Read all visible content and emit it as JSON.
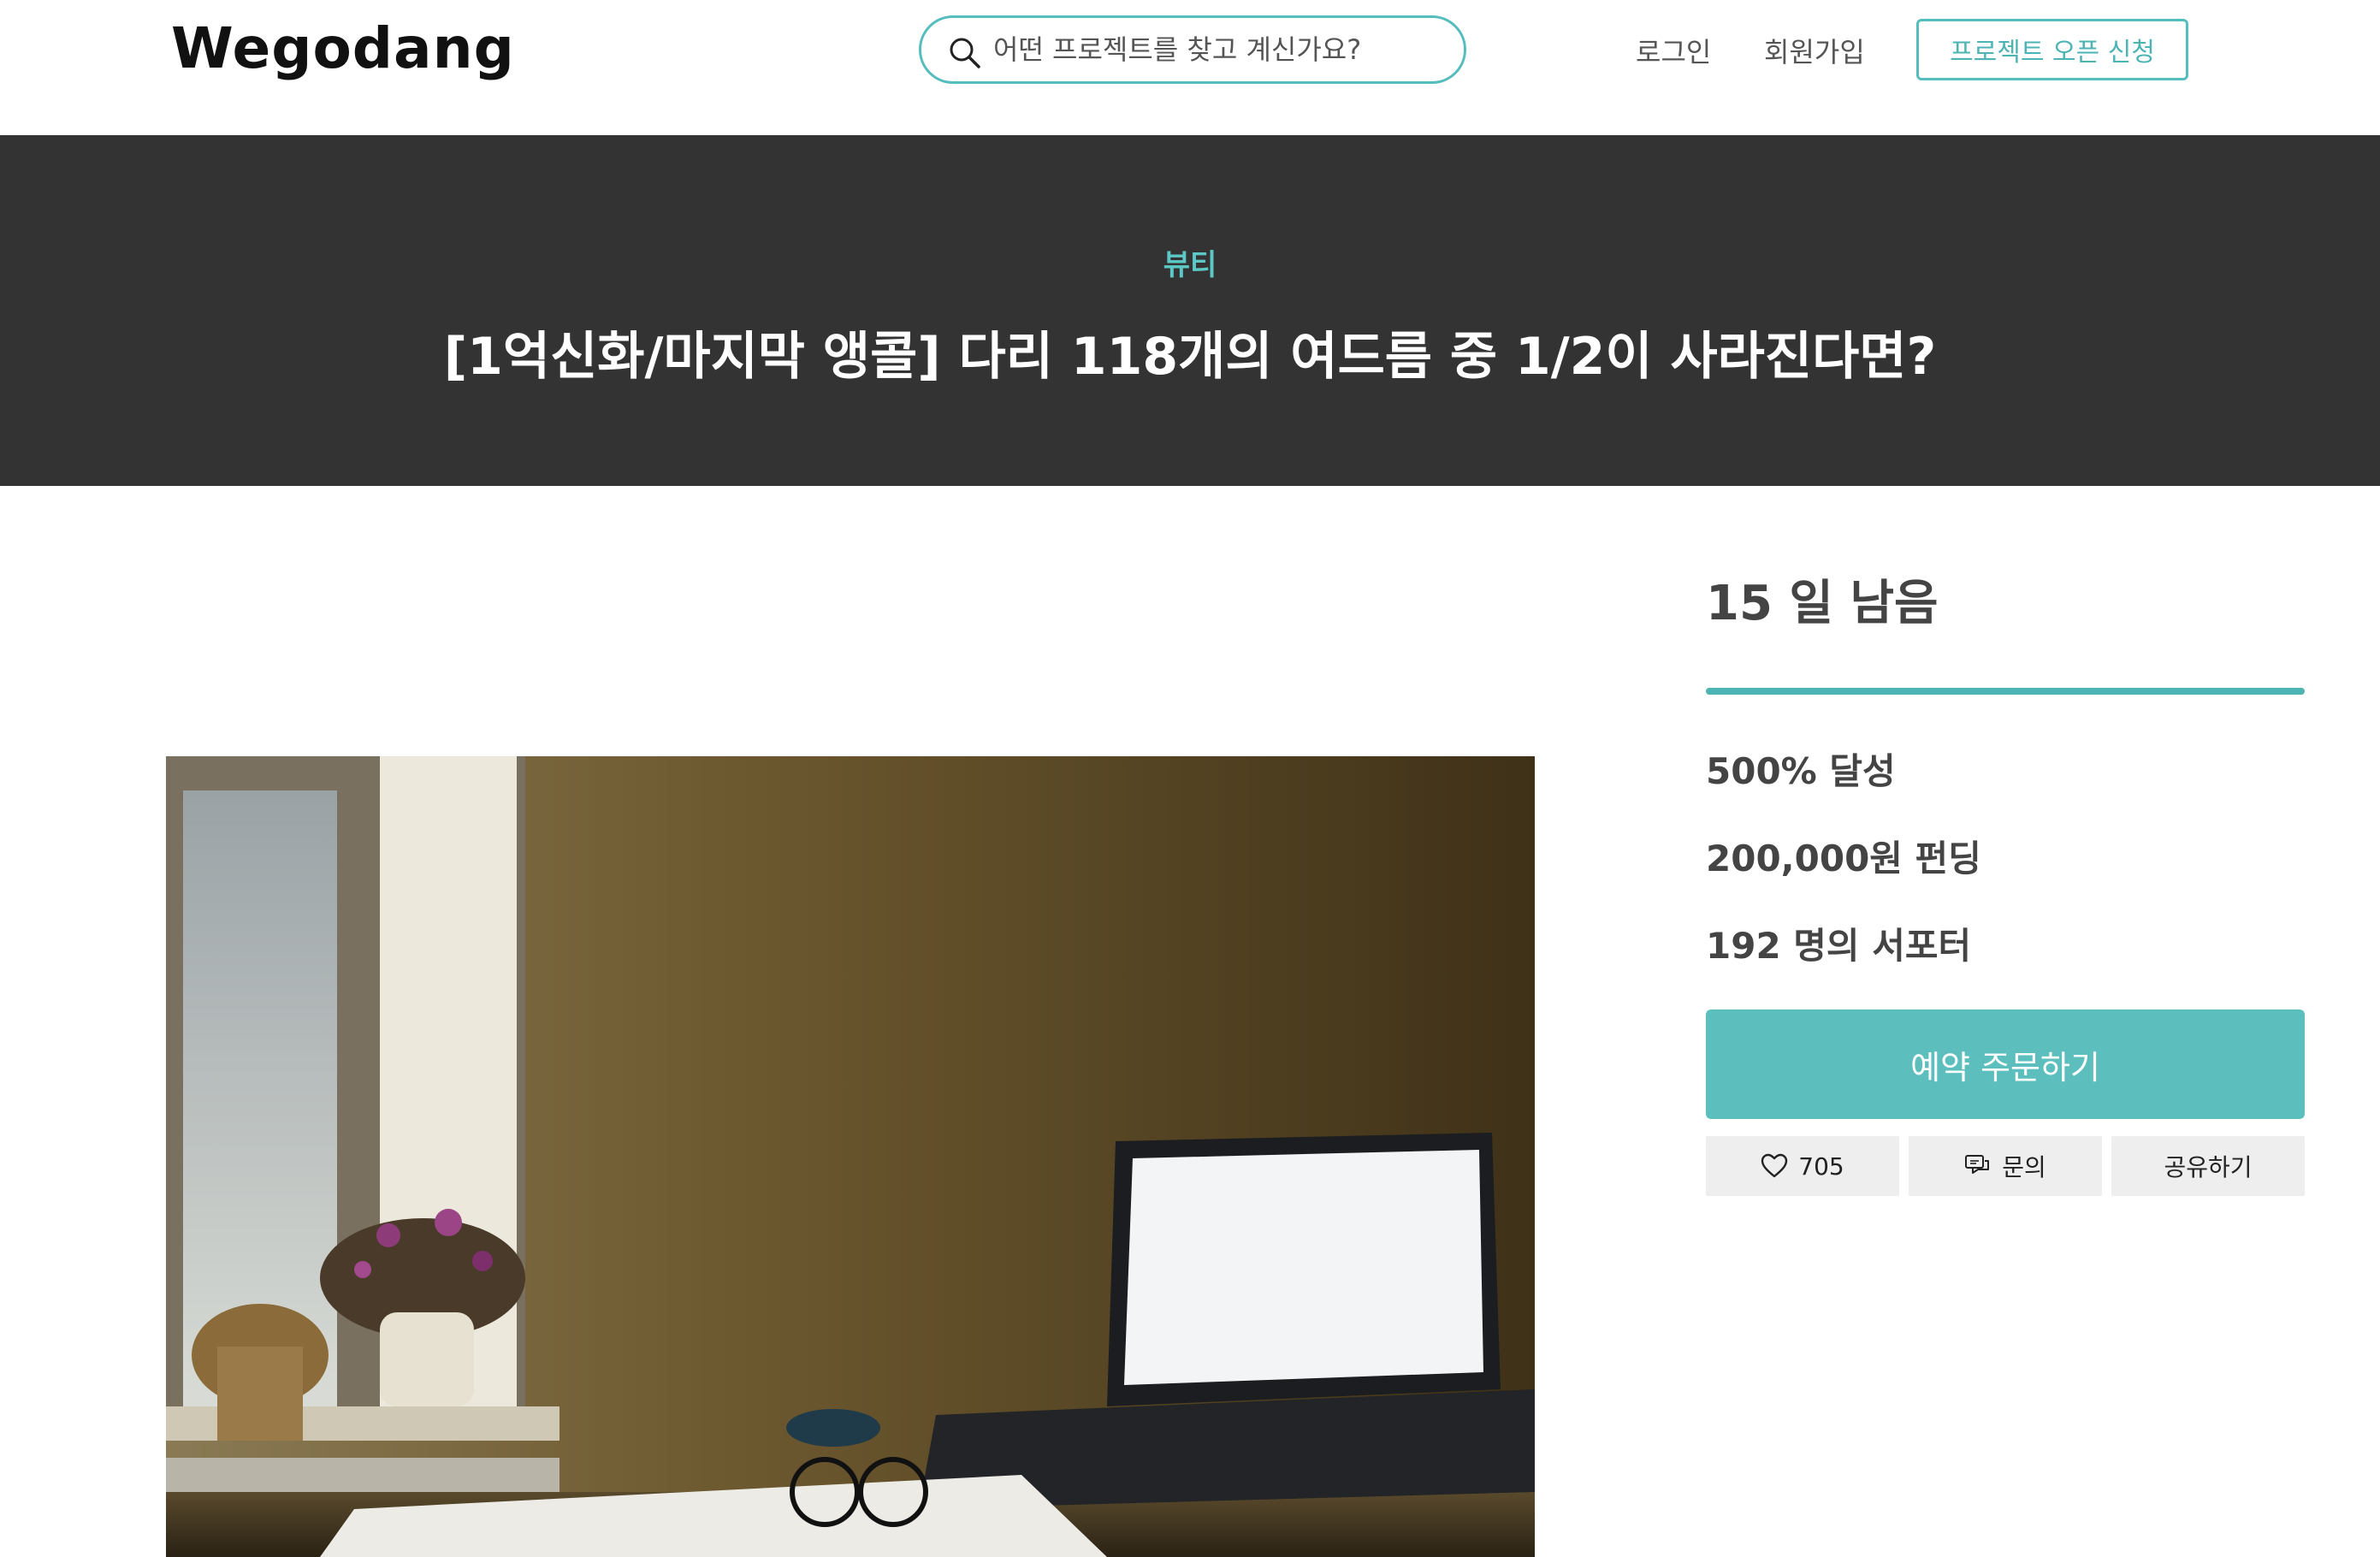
{
  "header": {
    "logo": "Wegodang",
    "search_placeholder": "어떤 프로젝트를 찾고 계신가요?",
    "login": "로그인",
    "signup": "회원가입",
    "open_project": "프로젝트 오픈 신청"
  },
  "hero": {
    "category": "뷰티",
    "title": "[1억신화/마지막 앵콜] 다리 118개의 여드름 중 1/2이 사라진다면?"
  },
  "funding": {
    "days_left": "15 일 남음",
    "progress_fraction": 1.0,
    "achievement": "500% 달성",
    "amount": "200,000원 펀딩",
    "backers": "192 명의 서포터",
    "reserve_button": "예약 주문하기",
    "likes": "705",
    "inquiry": "문의",
    "share": "공유하기"
  },
  "colors": {
    "accent": "#5cbfbe",
    "hero_bg": "#333333",
    "category": "#5cc9c6"
  },
  "icons": [
    "search-icon",
    "heart-icon",
    "chat-icon"
  ]
}
